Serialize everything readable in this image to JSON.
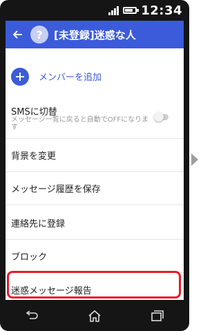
{
  "statusbar": {
    "time": "12:34"
  },
  "appbar": {
    "avatar_char": "?",
    "title": "[未登録]迷惑な人"
  },
  "menu": {
    "add_member": "メンバーを追加",
    "sms_title": "SMSに切替",
    "sms_subtitle": "メッセージ一覧に戻ると自動でOFFになります",
    "sms_toggle_on": false,
    "change_background": "背景を変更",
    "save_history": "メッセージ履歴を保存",
    "register_contact": "連絡先に登録",
    "block": "ブロック",
    "report_spam": "迷惑メッセージ報告"
  },
  "colors": {
    "accent": "#3b5bdb",
    "highlight": "#e8192c",
    "phone_frame": "#151515"
  }
}
